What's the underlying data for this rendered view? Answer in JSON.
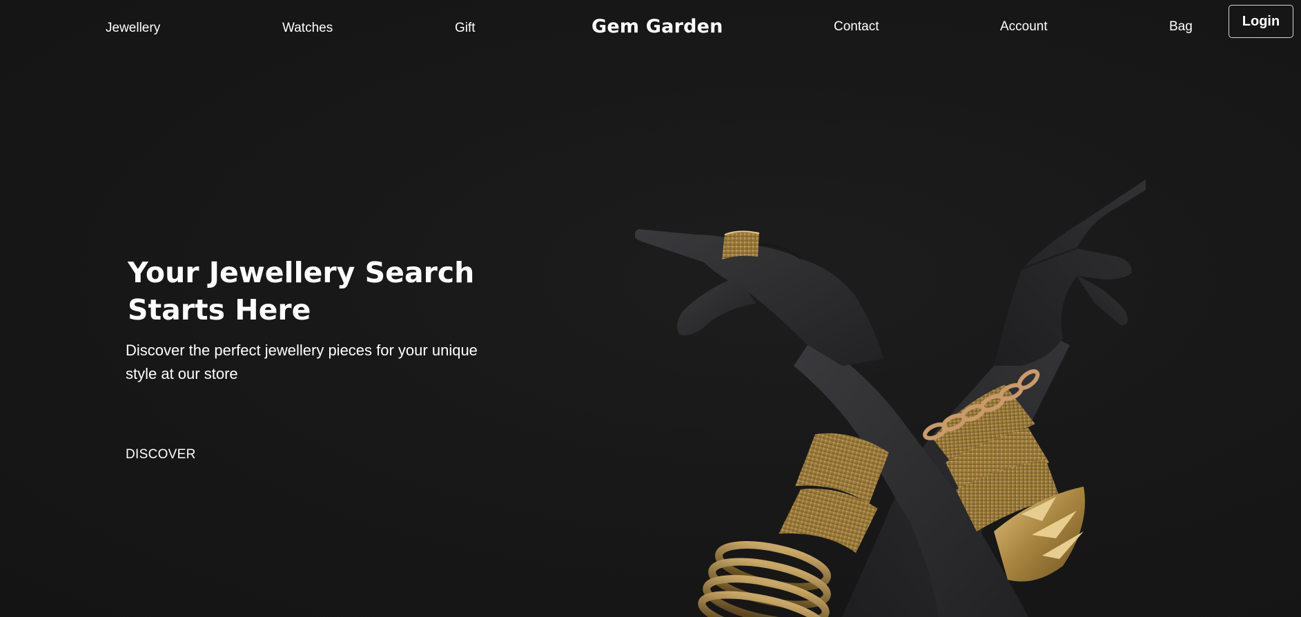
{
  "nav": {
    "left_links": [
      "Jewellery",
      "Watches",
      "Gift"
    ],
    "brand": "Gem Garden",
    "right_links": [
      "Contact",
      "Account",
      "Bag"
    ],
    "login_label": "Login"
  },
  "hero": {
    "title": "Your Jewellery Search Starts Here",
    "subtitle": "Discover the perfect jewellery pieces for your unique style at our store",
    "cta_label": "DISCOVER",
    "image": "crossed-hands-with-gold-bracelets-and-ring"
  },
  "colors": {
    "background": "#161616",
    "text": "#ffffff",
    "skin": "#2e2e30",
    "gold": "#b8944a"
  }
}
